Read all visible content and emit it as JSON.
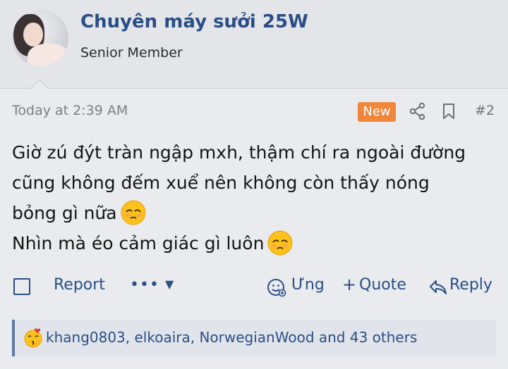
{
  "user": {
    "name": "Chuyên máy sưởi 25W",
    "title": "Senior Member"
  },
  "post": {
    "time": "Today at 2:39 AM",
    "badge": "New",
    "number": "#2",
    "lines": [
      "Giờ zú đýt tràn ngập mxh, thậm chí ra ngoài đường",
      "cũng không đếm xuể nên không còn thấy nóng",
      "bỏng gì nữa",
      "Nhìn mà éo cảm giác gì luôn"
    ]
  },
  "actions": {
    "report": "Report",
    "more": "•••",
    "react": "Ưng",
    "quote": "Quote",
    "reply": "Reply"
  },
  "reactions": {
    "text": "khang0803, elkoaira, NorwegianWood and 43 others"
  },
  "colors": {
    "link": "#2a4e86",
    "badge": "#f0873a",
    "muted": "#7b7f86"
  }
}
